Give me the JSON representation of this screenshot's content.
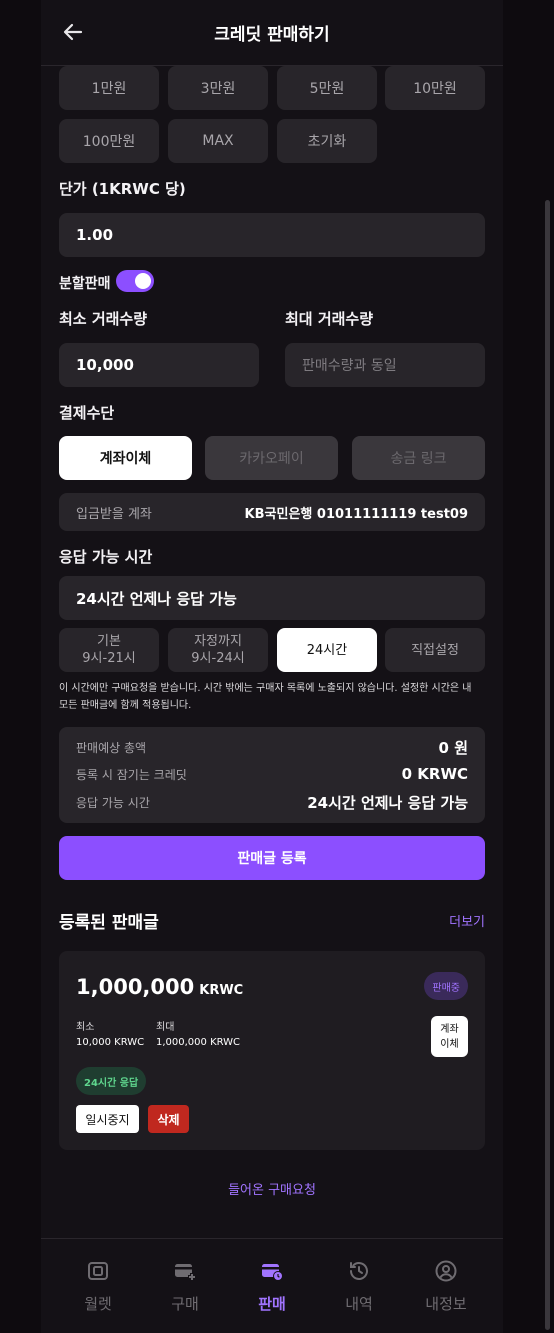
{
  "header": {
    "title": "크레딧 판매하기"
  },
  "amount_chips": [
    "1만원",
    "3만원",
    "5만원",
    "10만원",
    "100만원",
    "MAX",
    "초기화"
  ],
  "price": {
    "label": "단가 (1KRWC 당)",
    "value": "1.00"
  },
  "split": {
    "label": "분할판매",
    "enabled": true
  },
  "min_qty": {
    "label": "최소 거래수량",
    "value": "10,000"
  },
  "max_qty": {
    "label": "최대 거래수량",
    "placeholder": "판매수량과 동일"
  },
  "payment": {
    "label": "결제수단",
    "options": [
      "계좌이체",
      "카카오페이",
      "송금 링크"
    ],
    "selected": "계좌이체",
    "account_label": "입금받을 계좌",
    "account_value": "KB국민은행 01011111119 test09"
  },
  "response_time": {
    "label": "응답 가능 시간",
    "value": "24시간 언제나 응답 가능",
    "options": [
      {
        "line1": "기본",
        "line2": "9시-21시"
      },
      {
        "line1": "자정까지",
        "line2": "9시-24시"
      },
      {
        "line1": "24시간",
        "line2": ""
      },
      {
        "line1": "직접설정",
        "line2": ""
      }
    ],
    "selected": "24시간",
    "note_line1": "이 시간에만 구매요청을 받습니다. 시간 밖에는 구매자 목록에 노출되지 않습니다. 설정한 시간은 내",
    "note_line2": "모든 판매글에 함께 적용됩니다."
  },
  "summary": {
    "total_label": "판매예상 총액",
    "total_value": "0 원",
    "locked_label": "등록 시 잠기는 크레딧",
    "locked_value": "0 KRWC",
    "time_label": "응답 가능 시간",
    "time_value": "24시간 언제나 응답 가능"
  },
  "submit_label": "판매글 등록",
  "listings": {
    "title": "등록된 판매글",
    "more_label": "더보기",
    "items": [
      {
        "amount": "1,000,000",
        "unit": "KRWC",
        "status": "판매중",
        "min_label": "최소",
        "min_value": "10,000 KRWC",
        "max_label": "최대",
        "max_value": "1,000,000 KRWC",
        "method_line1": "계좌",
        "method_line2": "이체",
        "response_badge": "24시간 응답",
        "pause_label": "일시중지",
        "delete_label": "삭제"
      }
    ]
  },
  "incoming_requests_label": "들어온 구매요청",
  "tabbar": {
    "items": [
      {
        "label": "월렛",
        "icon": "wallet-icon"
      },
      {
        "label": "구매",
        "icon": "card-plus-icon"
      },
      {
        "label": "판매",
        "icon": "card-clock-icon"
      },
      {
        "label": "내역",
        "icon": "history-icon"
      },
      {
        "label": "내정보",
        "icon": "user-icon"
      }
    ],
    "active": "판매"
  },
  "colors": {
    "accent": "#8c4fff",
    "accent_text": "#a174ff",
    "background": "#141116",
    "surface": "#28252a"
  }
}
